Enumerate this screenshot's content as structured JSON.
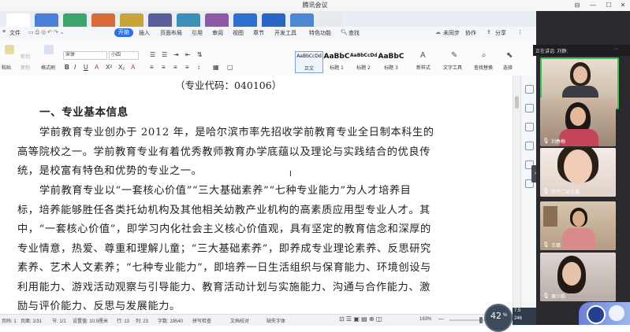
{
  "window": {
    "title": "腾讯会议"
  },
  "menu": {
    "file": "文件",
    "items": [
      "开始",
      "插入",
      "页面布局",
      "引用",
      "审阅",
      "视图",
      "章节",
      "开发工具",
      "特色功能"
    ],
    "search": "查找",
    "sync": "未同步",
    "collab": "协作",
    "share": "分享"
  },
  "ribbon": {
    "paste_group": [
      "剪切",
      "复制",
      "粘贴",
      "格式刷"
    ],
    "font_name": "宋体",
    "font_size": "小四",
    "styles": [
      {
        "preview": "AaBbCcDd",
        "label": "正文"
      },
      {
        "preview": "AaBbC",
        "label": "标题 1"
      },
      {
        "preview": "AaBbCcDd",
        "label": "标题 2"
      },
      {
        "preview": "AaBbC",
        "label": "标题 3"
      }
    ],
    "new_style": "新样式",
    "text_tools": "文字工具",
    "find_replace": "查找替换",
    "select": "选择"
  },
  "document": {
    "code_line": "（专业代码：040106）",
    "heading": "一、专业基本信息",
    "paragraphs": [
      [
        "学前教育专业创办于 2012 年，是哈尔滨市率先招收学前教育专业全日制本科生的",
        "高等院校之一。学前教育专业有着优秀教师教育办学底蕴以及理论与实践结合的优良传",
        "统，是校富有特色和优势的专业之一。"
      ],
      [
        "学前教育专业以“一套核心价值”“三大基础素养”“七种专业能力”为人才培养目",
        "标，培养能够胜任各类托幼机构及其他相关幼教产业机构的高素质应用型专业人才。其",
        "中，“一套核心价值”，即学习内化社会主义核心价值观，具有坚定的教育信念和深厚的",
        "专业情意，热爱、尊重和理解儿童；“三大基础素养”，即养成专业理论素养、反思研究",
        "素养、艺术人文素养；“七种专业能力”，即培养一日生活组织与保育能力、环境创设与",
        "利用能力、游戏活动观察与引导能力、教育活动计划与实施能力、沟通与合作能力、激",
        "励与评价能力、反思与发展能力。"
      ]
    ]
  },
  "status": {
    "page_num": "页码: 1",
    "page_of": "页面: 1/31",
    "section": "节: 1/1",
    "setting": "设置值: 10.9厘米",
    "row": "行: 13",
    "col": "列: 23",
    "wordcount": "字数: 19540",
    "spell": "拼写检查",
    "proof": "文档校对",
    "missing_font": "缺失字体",
    "zoom": "163%"
  },
  "meeting": {
    "speaking": "正在讲话: 刘静;",
    "participants": [
      {
        "name": "刘静",
        "speaking": true
      },
      {
        "name": "刘春梅",
        "speaking": false
      },
      {
        "name": "齐齐二幼王鑫",
        "speaking": false
      },
      {
        "name": "王璐",
        "speaking": false
      },
      {
        "name": "窦少皓",
        "speaking": false
      }
    ]
  },
  "network": {
    "percent": "42",
    "up": "7.5",
    "down": "246"
  }
}
